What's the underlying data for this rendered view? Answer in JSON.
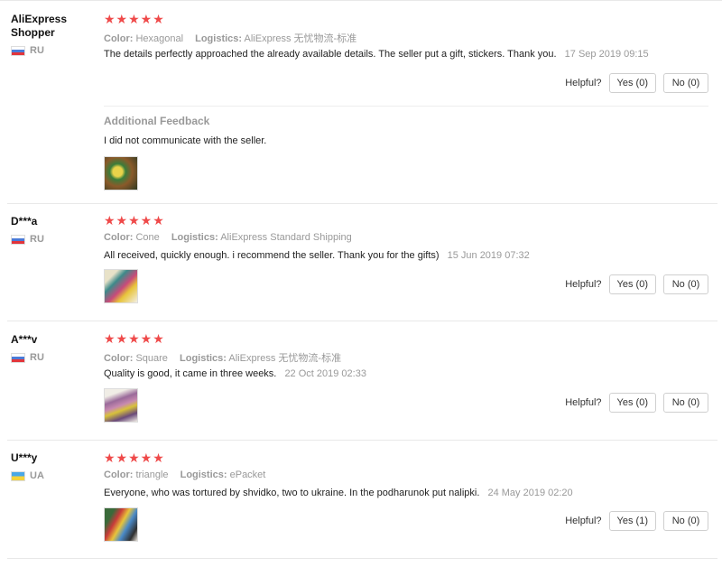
{
  "reviews": [
    {
      "user": "AliExpress Shopper",
      "country": "RU",
      "stars": "★★★★★",
      "color_label": "Color:",
      "color": "Hexagonal",
      "logistics_label": "Logistics:",
      "logistics": "AliExpress 无忧物流-标准",
      "text": "The details perfectly approached the already available details. The seller put a gift, stickers. Thank you.",
      "date": "17 Sep 2019 09:15",
      "helpful_label": "Helpful?",
      "yes": "Yes (0)",
      "no": "No (0)",
      "additional_title": "Additional Feedback",
      "additional_text": "I did not communicate with the seller."
    },
    {
      "user": "D***a",
      "country": "RU",
      "stars": "★★★★★",
      "color_label": "Color:",
      "color": "Cone",
      "logistics_label": "Logistics:",
      "logistics": "AliExpress Standard Shipping",
      "text": "All received, quickly enough. i recommend the seller. Thank you for the gifts)",
      "date": "15 Jun 2019 07:32",
      "helpful_label": "Helpful?",
      "yes": "Yes (0)",
      "no": "No (0)"
    },
    {
      "user": "A***v",
      "country": "RU",
      "stars": "★★★★★",
      "color_label": "Color:",
      "color": "Square",
      "logistics_label": "Logistics:",
      "logistics": "AliExpress 无忧物流-标准",
      "text": "Quality is good, it came in three weeks.",
      "date": "22 Oct 2019 02:33",
      "helpful_label": "Helpful?",
      "yes": "Yes (0)",
      "no": "No (0)"
    },
    {
      "user": "U***y",
      "country": "UA",
      "stars": "★★★★★",
      "color_label": "Color:",
      "color": "triangle",
      "logistics_label": "Logistics:",
      "logistics": "ePacket",
      "text": "Everyone, who was tortured by shvidko, two to ukraine. In the podharunok put nalipki.",
      "date": "24 May 2019 02:20",
      "helpful_label": "Helpful?",
      "yes": "Yes (1)",
      "no": "No (0)"
    }
  ]
}
